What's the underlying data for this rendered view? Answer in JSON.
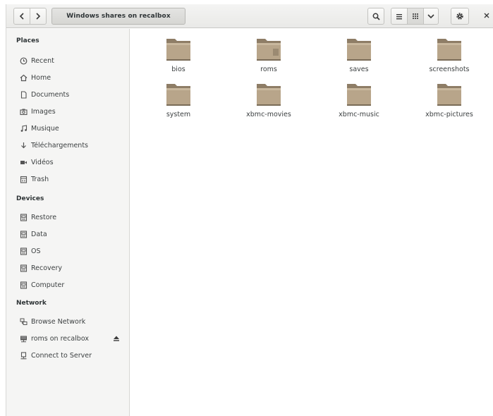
{
  "header": {
    "path_label": "Windows shares on recalbox"
  },
  "icons": {
    "back": "chevron-left-icon",
    "forward": "chevron-right-icon",
    "search": "search-icon",
    "list_view": "list-view-icon",
    "grid_view": "grid-view-icon",
    "view_options": "chevron-down-icon",
    "menu": "gear-icon",
    "close": "close-icon"
  },
  "sidebar": {
    "places_title": "Places",
    "places": [
      {
        "label": "Recent",
        "icon": "clock-icon"
      },
      {
        "label": "Home",
        "icon": "home-icon"
      },
      {
        "label": "Documents",
        "icon": "document-icon"
      },
      {
        "label": "Images",
        "icon": "camera-icon"
      },
      {
        "label": "Musique",
        "icon": "music-icon"
      },
      {
        "label": "Téléchargements",
        "icon": "download-icon"
      },
      {
        "label": "Vidéos",
        "icon": "video-icon"
      },
      {
        "label": "Trash",
        "icon": "trash-icon"
      }
    ],
    "devices_title": "Devices",
    "devices": [
      {
        "label": "Restore",
        "icon": "drive-icon"
      },
      {
        "label": "Data",
        "icon": "drive-icon"
      },
      {
        "label": "OS",
        "icon": "drive-icon"
      },
      {
        "label": "Recovery",
        "icon": "drive-icon"
      },
      {
        "label": "Computer",
        "icon": "drive-icon"
      }
    ],
    "network_title": "Network",
    "network": [
      {
        "label": "Browse Network",
        "icon": "network-icon"
      },
      {
        "label": "roms on recalbox",
        "icon": "network-share-icon",
        "ejectable": true
      },
      {
        "label": "Connect to Server",
        "icon": "server-icon"
      }
    ]
  },
  "folders": [
    {
      "name": "bios"
    },
    {
      "name": "roms"
    },
    {
      "name": "saves"
    },
    {
      "name": "screenshots"
    },
    {
      "name": "system"
    },
    {
      "name": "xbmc-movies"
    },
    {
      "name": "xbmc-music"
    },
    {
      "name": "xbmc-pictures"
    }
  ],
  "colors": {
    "folder_body": "#b8a58a",
    "folder_dark": "#8e7d66",
    "folder_tab": "#c9b89e"
  }
}
